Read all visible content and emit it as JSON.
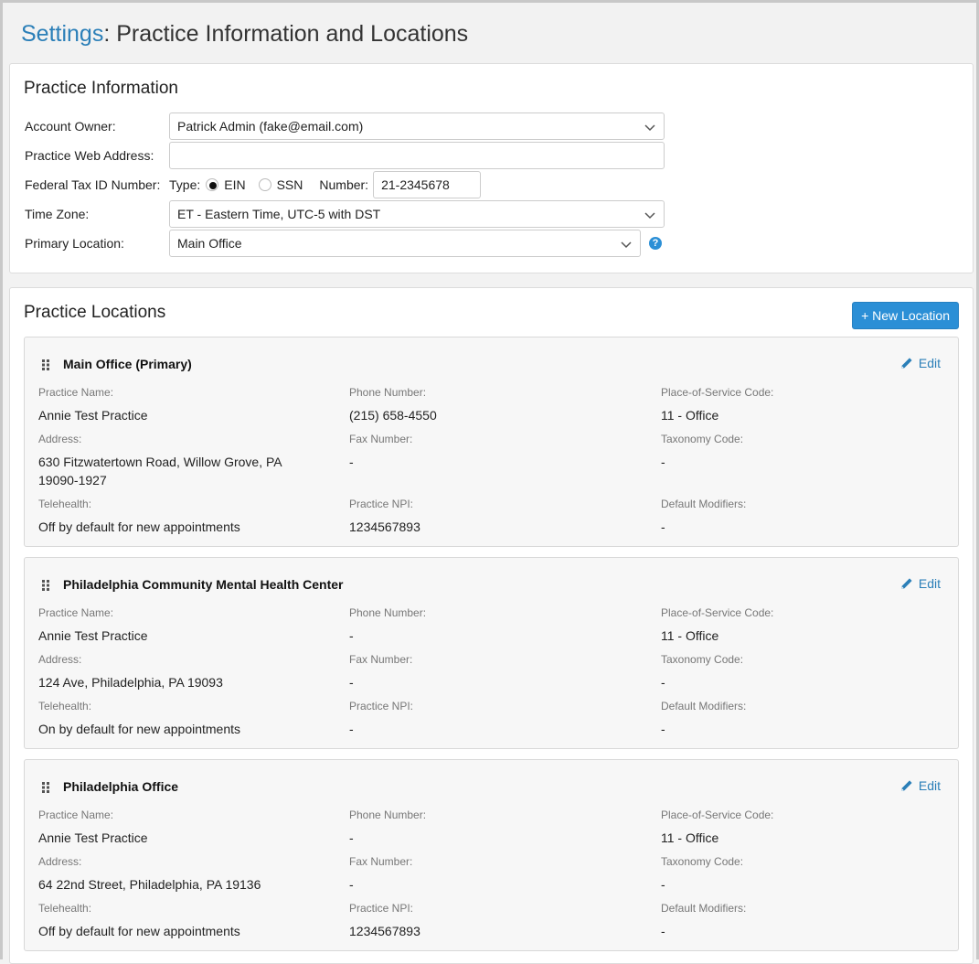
{
  "header": {
    "crumb": "Settings",
    "separator": ":",
    "title": " Practice Information and Locations"
  },
  "practice_info": {
    "heading": "Practice Information",
    "account_owner_label": "Account Owner:",
    "account_owner_value": "Patrick Admin (fake@email.com)",
    "web_address_label": "Practice Web Address:",
    "web_address_value": "",
    "tax_id_label": "Federal Tax ID Number:",
    "type_label": "Type:",
    "ein_label": "EIN",
    "ssn_label": "SSN",
    "selected_type": "EIN",
    "number_label": "Number:",
    "number_value": "21-2345678",
    "time_zone_label": "Time Zone:",
    "time_zone_value": "ET - Eastern Time, UTC-5 with DST",
    "primary_location_label": "Primary Location:",
    "primary_location_value": "Main Office",
    "help_icon": "question-circle-icon"
  },
  "practice_locations": {
    "heading": "Practice Locations",
    "new_button": "+ New Location",
    "edit_label": "Edit",
    "field_labels": {
      "practice_name": "Practice Name:",
      "phone": "Phone Number:",
      "pos_code": "Place-of-Service Code:",
      "address": "Address:",
      "fax": "Fax Number:",
      "taxonomy": "Taxonomy Code:",
      "telehealth": "Telehealth:",
      "npi": "Practice NPI:",
      "modifiers": "Default Modifiers:"
    },
    "locations": [
      {
        "name": "Main Office (Primary)",
        "practice_name": "Annie Test Practice",
        "phone": "(215) 658-4550",
        "pos_code": "11 - Office",
        "address": "630 Fitzwatertown Road, Willow Grove, PA 19090-1927",
        "fax": "-",
        "taxonomy": "-",
        "telehealth": "Off by default for new appointments",
        "npi": "1234567893",
        "modifiers": "-"
      },
      {
        "name": "Philadelphia Community Mental Health Center",
        "practice_name": "Annie Test Practice",
        "phone": "-",
        "pos_code": "11 - Office",
        "address": "124 Ave, Philadelphia, PA 19093",
        "fax": "-",
        "taxonomy": "-",
        "telehealth": "On by default for new appointments",
        "npi": "-",
        "modifiers": "-"
      },
      {
        "name": "Philadelphia Office",
        "practice_name": "Annie Test Practice",
        "phone": "-",
        "pos_code": "11 - Office",
        "address": "64 22nd Street, Philadelphia, PA 19136",
        "fax": "-",
        "taxonomy": "-",
        "telehealth": "Off by default for new appointments",
        "npi": "1234567893",
        "modifiers": "-"
      }
    ]
  },
  "colors": {
    "accent": "#2b8fd6",
    "link": "#2b7fb8",
    "background": "#f2f2f2",
    "card": "#f7f7f7"
  }
}
